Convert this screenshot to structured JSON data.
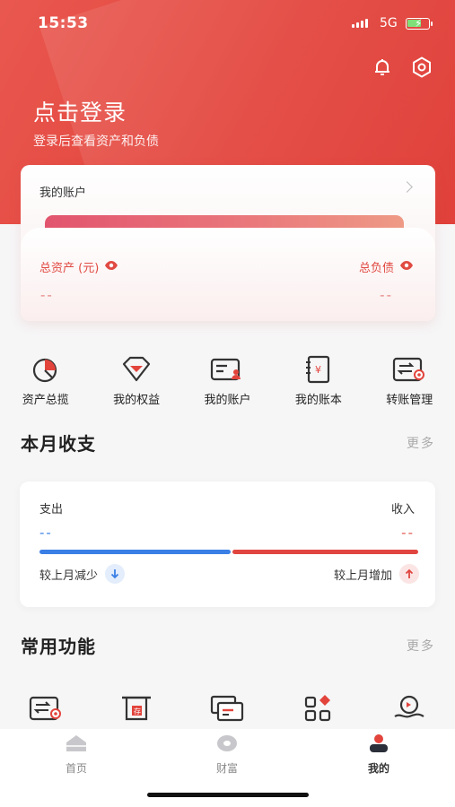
{
  "status_bar": {
    "time": "15:53",
    "network": "5G"
  },
  "header": {
    "login_title": "点击登录",
    "login_subtitle": "登录后查看资产和负债",
    "icons": [
      "bell-icon",
      "settings-hex-icon"
    ]
  },
  "account_card": {
    "title": "我的账户",
    "total_assets_label": "总资产 (元)",
    "total_assets_value": "--",
    "total_liabilities_label": "总负债",
    "total_liabilities_value": "--"
  },
  "quick_actions": [
    {
      "label": "资产总揽",
      "icon": "pie-chart-icon"
    },
    {
      "label": "我的权益",
      "icon": "diamond-icon"
    },
    {
      "label": "我的账户",
      "icon": "account-card-icon"
    },
    {
      "label": "我的账本",
      "icon": "ledger-book-icon"
    },
    {
      "label": "转账管理",
      "icon": "transfer-icon"
    }
  ],
  "monthly": {
    "title": "本月收支",
    "more": "更多",
    "expense_label": "支出",
    "expense_value": "--",
    "income_label": "收入",
    "income_value": "--",
    "expense_compare": "较上月减少",
    "income_compare": "较上月增加",
    "colors": {
      "expense": "#3a7fe6",
      "income": "#e0463f"
    }
  },
  "common_functions": {
    "title": "常用功能",
    "more": "更多",
    "icons": [
      "transfer-card-icon",
      "atm-icon",
      "cards-icon",
      "apps-grid-icon",
      "hand-coin-icon"
    ]
  },
  "tab_bar": {
    "tabs": [
      {
        "label": "首页",
        "icon": "home-icon",
        "active": false
      },
      {
        "label": "财富",
        "icon": "wealth-icon",
        "active": false
      },
      {
        "label": "我的",
        "icon": "profile-icon",
        "active": true
      }
    ]
  },
  "brand_color": "#e2443c"
}
